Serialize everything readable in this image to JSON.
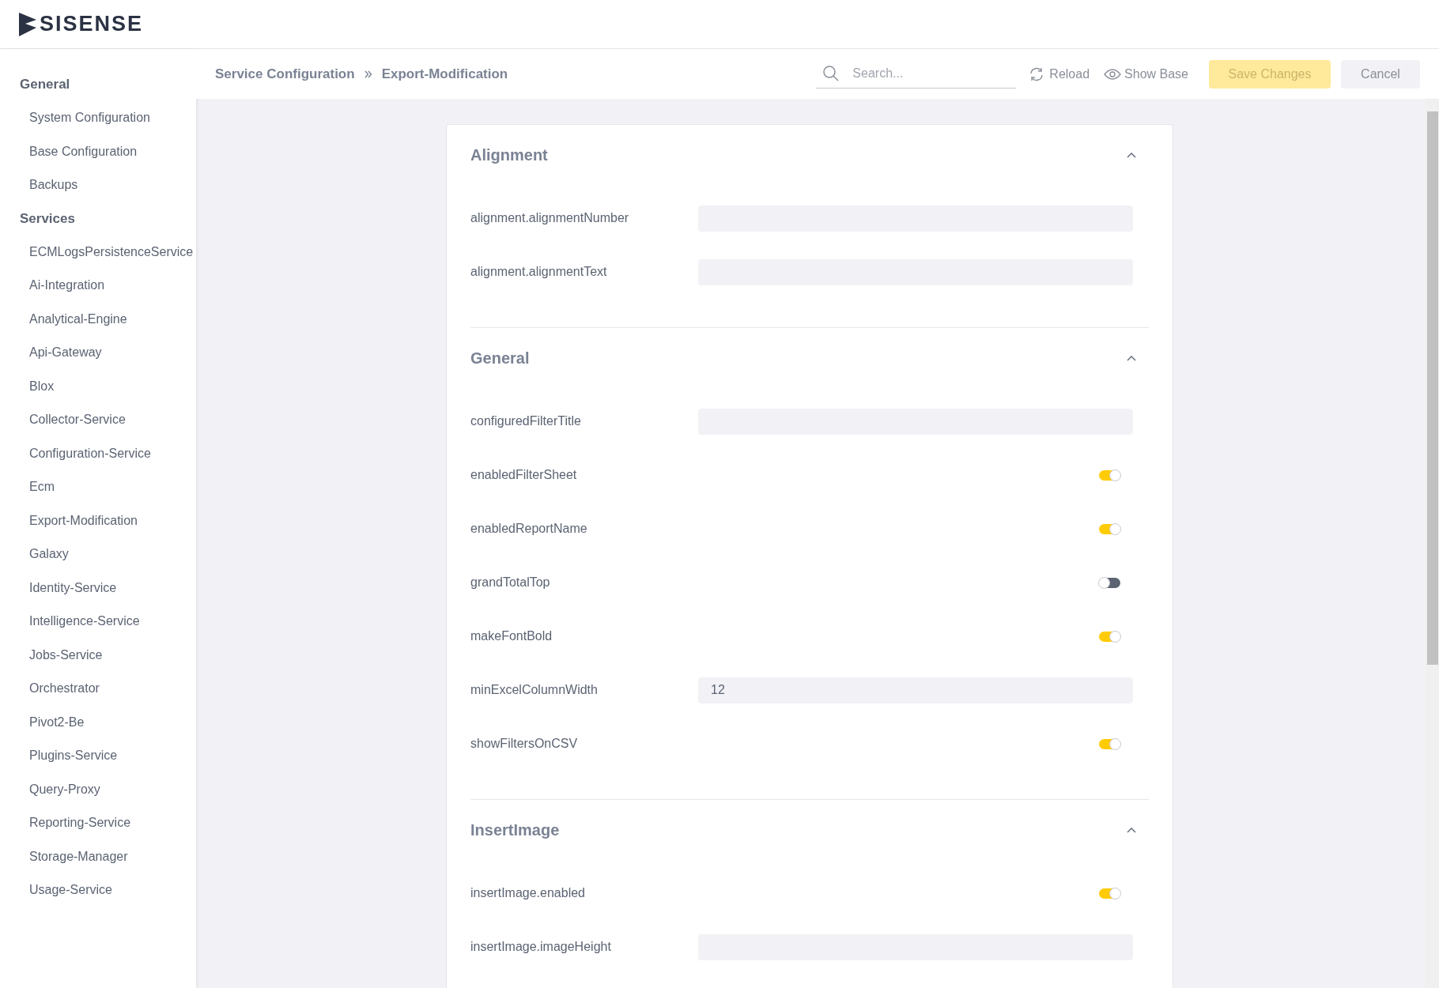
{
  "logo": {
    "text": "SISENSE"
  },
  "sidebar": {
    "groups": [
      {
        "heading": "General",
        "items": [
          "System Configuration",
          "Base Configuration",
          "Backups"
        ]
      },
      {
        "heading": "Services",
        "items": [
          "ECMLogsPersistenceService",
          "Ai-Integration",
          "Analytical-Engine",
          "Api-Gateway",
          "Blox",
          "Collector-Service",
          "Configuration-Service",
          "Ecm",
          "Export-Modification",
          "Galaxy",
          "Identity-Service",
          "Intelligence-Service",
          "Jobs-Service",
          "Orchestrator",
          "Pivot2-Be",
          "Plugins-Service",
          "Query-Proxy",
          "Reporting-Service",
          "Storage-Manager",
          "Usage-Service"
        ]
      }
    ]
  },
  "breadcrumb": [
    "Service Configuration",
    "Export-Modification"
  ],
  "toolbar": {
    "search": {
      "placeholder": "Search..."
    },
    "reload": "Reload",
    "show_base": "Show Base",
    "save": {
      "label": "Save Changes",
      "disabled": true
    },
    "cancel": "Cancel"
  },
  "sections": [
    {
      "title": "Alignment",
      "expanded": true,
      "fields": [
        {
          "kind": "text",
          "label": "alignment.alignmentNumber"
        },
        {
          "kind": "text",
          "label": "alignment.alignmentText"
        }
      ]
    },
    {
      "title": "General",
      "expanded": true,
      "fields": [
        {
          "kind": "text",
          "label": "configuredFilterTitle"
        },
        {
          "kind": "toggle",
          "label": "enabledFilterSheet",
          "on": true
        },
        {
          "kind": "toggle",
          "label": "enabledReportName",
          "on": true
        },
        {
          "kind": "toggle",
          "label": "grandTotalTop",
          "on": false
        },
        {
          "kind": "toggle",
          "label": "makeFontBold",
          "on": true
        },
        {
          "kind": "text",
          "label": "minExcelColumnWidth",
          "value": "12"
        },
        {
          "kind": "toggle",
          "label": "showFiltersOnCSV",
          "on": true
        }
      ]
    },
    {
      "title": "InsertImage",
      "expanded": true,
      "fields": [
        {
          "kind": "toggle",
          "label": "insertImage.enabled",
          "on": true
        },
        {
          "kind": "text",
          "label": "insertImage.imageHeight"
        }
      ]
    }
  ]
}
